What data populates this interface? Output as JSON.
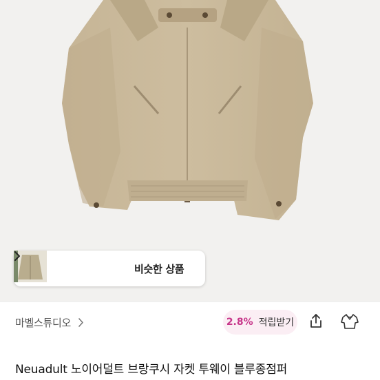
{
  "product_image": {
    "alt": "jacket-photo"
  },
  "similar": {
    "label": "비슷한 상품",
    "thumbnails": [
      "jacket-thumb-1",
      "jacket-thumb-2",
      "jacket-thumb-3"
    ]
  },
  "shop": {
    "name": "마벨스튜디오"
  },
  "points": {
    "rate": "2.8%",
    "label": "적립받기"
  },
  "actions": {
    "share_icon": "share-icon",
    "outfit_icon": "outfit-icon"
  },
  "product": {
    "title": "Neuadult 노이어덜트 브랑쿠시 자켓 투웨이 블루종점퍼"
  },
  "colors": {
    "accent": "#c7368a",
    "chip_bg": "#fbeef4",
    "jacket": "#c9b89a"
  }
}
